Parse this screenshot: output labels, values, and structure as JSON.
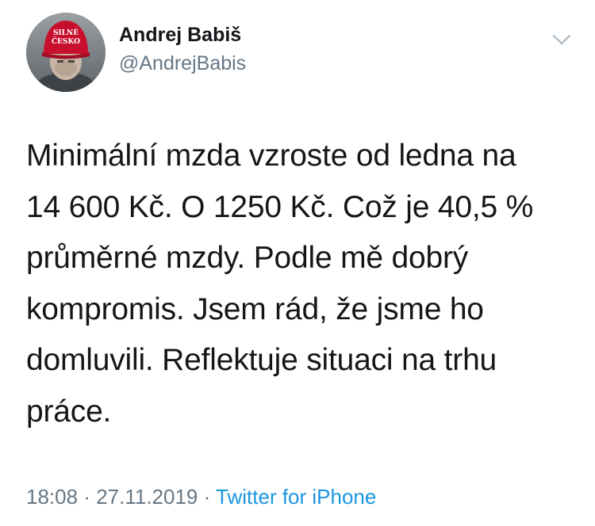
{
  "author": {
    "display_name": "Andrej Babiš",
    "handle": "@AndrejBabis",
    "avatar_icon": "profile-photo-red-cap",
    "avatar_cap_text": [
      "SILNÉ",
      "ČESKO"
    ]
  },
  "menu_icon": "chevron-down-icon",
  "tweet": {
    "text": "Minimální mzda vzroste od ledna na\n14 600 Kč. O 1250 Kč. Což je 40,5 %\nprůměrné mzdy. Podle mě dobrý\nkompromis. Jsem rád, že jsme ho\ndomluvili. Reflektuje situaci na trhu\npráce."
  },
  "meta": {
    "time": "18:08",
    "separator": " · ",
    "date": "27.11.2019",
    "source": "Twitter for iPhone"
  },
  "colors": {
    "text": "#14171a",
    "secondary": "#657786",
    "link": "#1b95e0",
    "cap_red": "#c8102e"
  }
}
